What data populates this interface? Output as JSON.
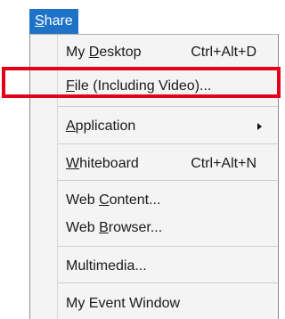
{
  "menu": {
    "title": {
      "accel": "S",
      "rest": "hare"
    }
  },
  "items": [
    {
      "pre": "My ",
      "accel": "D",
      "post": "esktop",
      "shortcut": "Ctrl+Alt+D"
    },
    {
      "pre": "",
      "accel": "F",
      "post": "ile (Including Video)...",
      "shortcut": ""
    },
    {
      "pre": "",
      "accel": "A",
      "post": "pplication",
      "shortcut": ""
    },
    {
      "pre": "",
      "accel": "W",
      "post": "hiteboard",
      "shortcut": "Ctrl+Alt+N"
    },
    {
      "pre": "Web ",
      "accel": "C",
      "post": "ontent...",
      "shortcut": ""
    },
    {
      "pre": "Web ",
      "accel": "B",
      "post": "rowser...",
      "shortcut": ""
    },
    {
      "pre": "Multimedia...",
      "accel": "",
      "post": "",
      "shortcut": ""
    },
    {
      "pre": "My Event Window",
      "accel": "",
      "post": "",
      "shortcut": ""
    }
  ],
  "colors": {
    "title_bg": "#1e73c8",
    "highlight": "#e2001a",
    "panel_bg": "#f4f4f4"
  }
}
